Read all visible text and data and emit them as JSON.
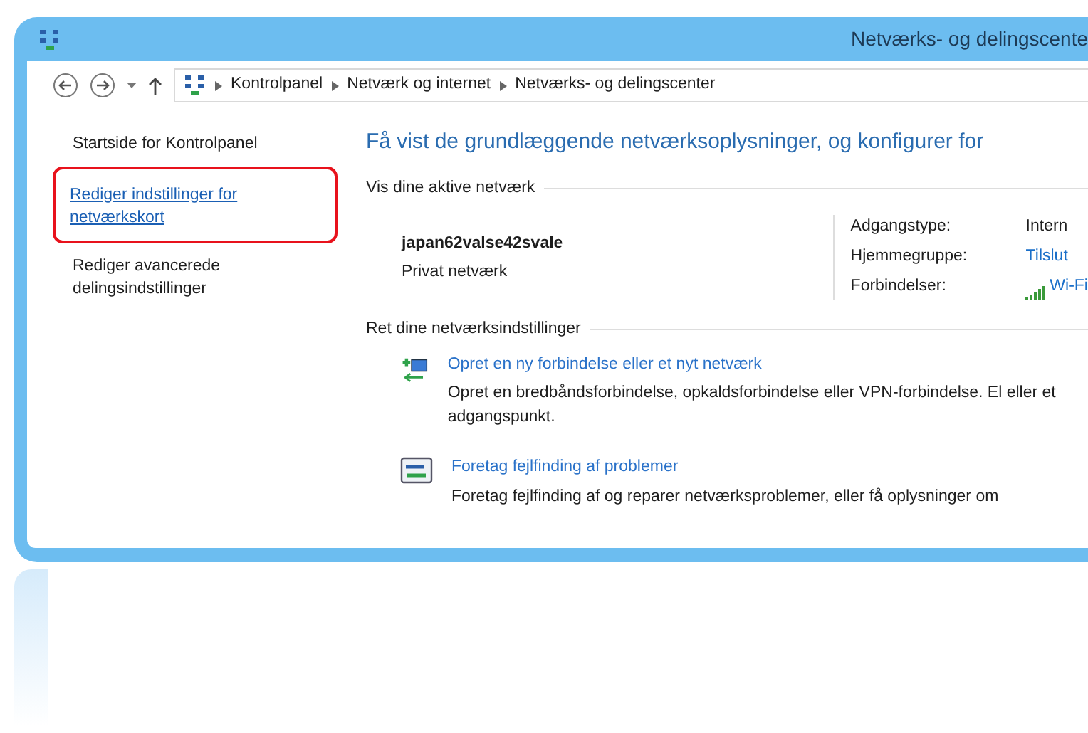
{
  "window": {
    "title": "Netværks- og delingscente"
  },
  "address_bar": {
    "breadcrumb": [
      "Kontrolpanel",
      "Netværk og internet",
      "Netværks- og delingscenter"
    ]
  },
  "sidebar": {
    "items": [
      {
        "text": "Startside for Kontrolpanel",
        "kind": "plain",
        "highlighted": false
      },
      {
        "text": "Rediger indstillinger for netværkskort",
        "kind": "link",
        "highlighted": true
      },
      {
        "text": "Rediger avancerede delingsindstillinger",
        "kind": "plain",
        "highlighted": false
      }
    ]
  },
  "main": {
    "heading": "Få vist de grundlæggende netværksoplysninger, og konfigurer for",
    "active_networks": {
      "label": "Vis dine aktive netværk",
      "network": {
        "name": "japan62valse42svale",
        "type": "Privat netværk"
      },
      "details": [
        {
          "label": "Adgangstype:",
          "value": "Intern",
          "kind": "text"
        },
        {
          "label": "Hjemmegruppe:",
          "value": "Tilslut",
          "kind": "link"
        },
        {
          "label": "Forbindelser:",
          "value": "Wi-Fi",
          "kind": "connection"
        }
      ]
    },
    "settings": {
      "label": "Ret dine netværksindstillinger",
      "tasks": [
        {
          "kind": "new-connection",
          "link": "Opret en ny forbindelse eller et nyt netværk",
          "description": "Opret en bredbåndsforbindelse, opkaldsforbindelse eller VPN-forbindelse. El eller et adgangspunkt."
        },
        {
          "kind": "troubleshoot",
          "link": "Foretag fejlfinding af problemer",
          "description": "Foretag fejlfinding af og reparer netværksproblemer, eller få oplysninger om"
        }
      ]
    }
  }
}
